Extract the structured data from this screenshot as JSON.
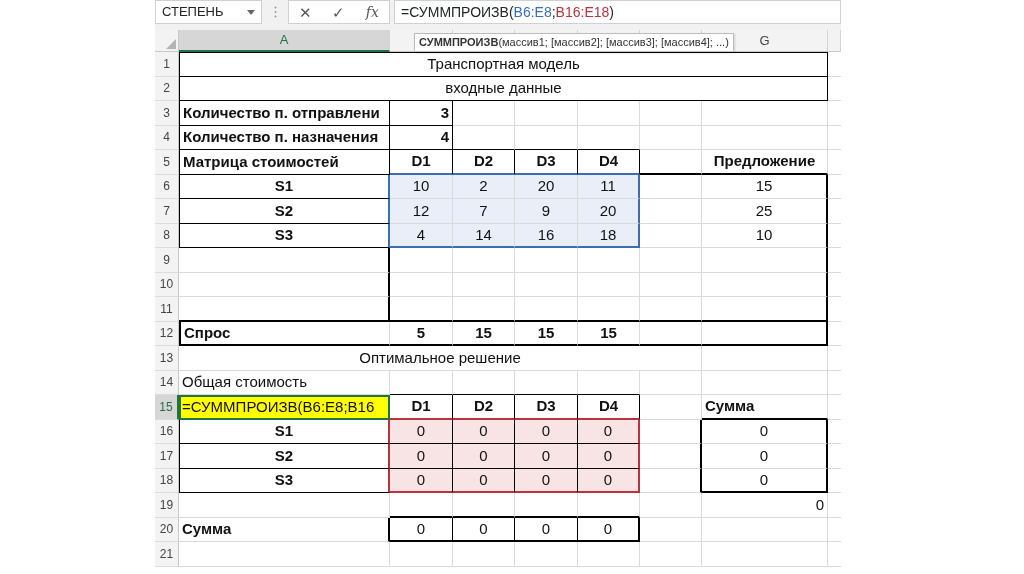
{
  "formula_bar": {
    "name_box": "СТЕПЕНЬ",
    "cancel_button": "✕",
    "enter_button": "✓",
    "function_button": "fx",
    "formula": [
      {
        "text": "=СУММПРОИЗВ("
      },
      {
        "text": "B6:E8",
        "color": "#3c6eb4"
      },
      {
        "text": ";"
      },
      {
        "text": "B16:E18",
        "color": "#b8323f"
      },
      {
        "text": ")"
      }
    ]
  },
  "tooltip": "**СУММПРОИЗВ**(массив1; [массив2]; [массив3]; [массив4]; ...)",
  "sheet": {
    "column_headers": {
      "A": {
        "label": "A",
        "selected": true
      },
      "G": {
        "label": "G",
        "selected": false
      }
    },
    "rows": [
      {
        "number": "1",
        "selected": false,
        "cells": {
          "A": {
            "text": "Транспортная модель",
            "kind": "title"
          }
        }
      },
      {
        "number": "2",
        "selected": false,
        "cells": {
          "A": {
            "text": "входные данные",
            "kind": "title"
          }
        }
      },
      {
        "number": "3",
        "selected": false,
        "cells": {
          "A": {
            "text": "Количество п. отправлени",
            "kind": "heading"
          },
          "B": {
            "text": "3",
            "kind": "count"
          }
        }
      },
      {
        "number": "4",
        "selected": false,
        "cells": {
          "A": {
            "text": "Количество п. назначения",
            "kind": "heading"
          },
          "B": {
            "text": "4",
            "kind": "count"
          }
        }
      },
      {
        "number": "5",
        "selected": false,
        "cells": {
          "A": {
            "text": "Матрица стоимостей",
            "kind": "heading"
          },
          "B": {
            "text": "D1",
            "kind": "label"
          },
          "C": {
            "text": "D2",
            "kind": "label"
          },
          "D": {
            "text": "D3",
            "kind": "label"
          },
          "E": {
            "text": "D4",
            "kind": "label"
          },
          "G": {
            "text": "Предложение",
            "kind": "label"
          }
        }
      },
      {
        "number": "6",
        "selected": false,
        "cells": {
          "A": {
            "text": "S1",
            "kind": "label"
          },
          "B": {
            "text": "10",
            "kind": "number"
          },
          "C": {
            "text": "2",
            "kind": "number"
          },
          "D": {
            "text": "20",
            "kind": "number"
          },
          "E": {
            "text": "11",
            "kind": "number"
          },
          "G": {
            "text": "15",
            "kind": "number"
          }
        }
      },
      {
        "number": "7",
        "selected": false,
        "cells": {
          "A": {
            "text": "S2",
            "kind": "label"
          },
          "B": {
            "text": "12",
            "kind": "number"
          },
          "C": {
            "text": "7",
            "kind": "number"
          },
          "D": {
            "text": "9",
            "kind": "number"
          },
          "E": {
            "text": "20",
            "kind": "number"
          },
          "G": {
            "text": "25",
            "kind": "number"
          }
        }
      },
      {
        "number": "8",
        "selected": false,
        "cells": {
          "A": {
            "text": "S3",
            "kind": "label"
          },
          "B": {
            "text": "4",
            "kind": "number"
          },
          "C": {
            "text": "14",
            "kind": "number"
          },
          "D": {
            "text": "16",
            "kind": "number"
          },
          "E": {
            "text": "18",
            "kind": "number"
          },
          "G": {
            "text": "10",
            "kind": "number"
          }
        }
      },
      {
        "number": "9",
        "selected": false
      },
      {
        "number": "10",
        "selected": false
      },
      {
        "number": "11",
        "selected": false
      },
      {
        "number": "12",
        "selected": false,
        "cells": {
          "A": {
            "text": "Спрос",
            "kind": "heading"
          },
          "B": {
            "text": "5",
            "kind": "label"
          },
          "C": {
            "text": "15",
            "kind": "label"
          },
          "D": {
            "text": "15",
            "kind": "label"
          },
          "E": {
            "text": "15",
            "kind": "label"
          }
        }
      },
      {
        "number": "13",
        "selected": false,
        "cells": {
          "A": {
            "text": "Оптимальное решение",
            "kind": "title"
          }
        }
      },
      {
        "number": "14",
        "selected": false,
        "cells": {
          "A": {
            "text": "Общая стоимость",
            "kind": "note"
          }
        }
      },
      {
        "number": "15",
        "selected": true,
        "cells": {
          "A": {
            "text": "=СУММПРОИЗВ(B6:E8;B16",
            "kind": "formula"
          },
          "B": {
            "text": "D1",
            "kind": "label"
          },
          "C": {
            "text": "D2",
            "kind": "label"
          },
          "D": {
            "text": "D3",
            "kind": "label"
          },
          "E": {
            "text": "D4",
            "kind": "label"
          },
          "G": {
            "text": "Сумма",
            "kind": "heading"
          }
        }
      },
      {
        "number": "16",
        "selected": false,
        "cells": {
          "A": {
            "text": "S1",
            "kind": "label"
          },
          "B": {
            "text": "0",
            "kind": "number"
          },
          "C": {
            "text": "0",
            "kind": "number"
          },
          "D": {
            "text": "0",
            "kind": "number"
          },
          "E": {
            "text": "0",
            "kind": "number"
          },
          "G": {
            "text": "0",
            "kind": "number"
          }
        }
      },
      {
        "number": "17",
        "selected": false,
        "cells": {
          "A": {
            "text": "S2",
            "kind": "label"
          },
          "B": {
            "text": "0",
            "kind": "number"
          },
          "C": {
            "text": "0",
            "kind": "number"
          },
          "D": {
            "text": "0",
            "kind": "number"
          },
          "E": {
            "text": "0",
            "kind": "number"
          },
          "G": {
            "text": "0",
            "kind": "number"
          }
        }
      },
      {
        "number": "18",
        "selected": false,
        "cells": {
          "A": {
            "text": "S3",
            "kind": "label"
          },
          "B": {
            "text": "0",
            "kind": "number"
          },
          "C": {
            "text": "0",
            "kind": "number"
          },
          "D": {
            "text": "0",
            "kind": "number"
          },
          "E": {
            "text": "0",
            "kind": "number"
          },
          "G": {
            "text": "0",
            "kind": "number"
          }
        }
      },
      {
        "number": "19",
        "selected": false,
        "cells": {
          "G": {
            "text": "0",
            "kind": "total"
          }
        }
      },
      {
        "number": "20",
        "selected": false,
        "cells": {
          "A": {
            "text": "Сумма",
            "kind": "heading"
          },
          "B": {
            "text": "0",
            "kind": "number"
          },
          "C": {
            "text": "0",
            "kind": "number"
          },
          "D": {
            "text": "0",
            "kind": "number"
          },
          "E": {
            "text": "0",
            "kind": "number"
          }
        }
      },
      {
        "number": "21",
        "selected": false
      }
    ]
  }
}
